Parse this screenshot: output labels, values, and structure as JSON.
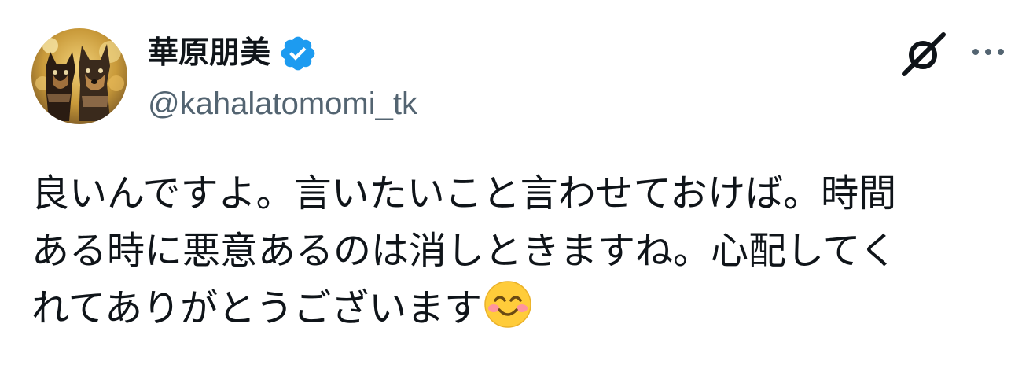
{
  "author": {
    "display_name": "華原朋美",
    "handle": "@kahalatomomi_tk",
    "verified": true,
    "avatar": "avatar-photo-two-dogs"
  },
  "toolbar": {
    "grok_icon": "grok-icon",
    "more_icon": "more-options-icon"
  },
  "tweet": {
    "lines": [
      "良いんですよ。言いたいこと言わせておけば。時間",
      "ある時に悪意あるのは消しときますね。心配してく",
      "れてありがとうございます"
    ],
    "emoji": "smiling-face-with-smiling-eyes-emoji"
  },
  "colors": {
    "text": "#0f1419",
    "secondary": "#536471",
    "verified_badge": "#1d9bf0"
  }
}
